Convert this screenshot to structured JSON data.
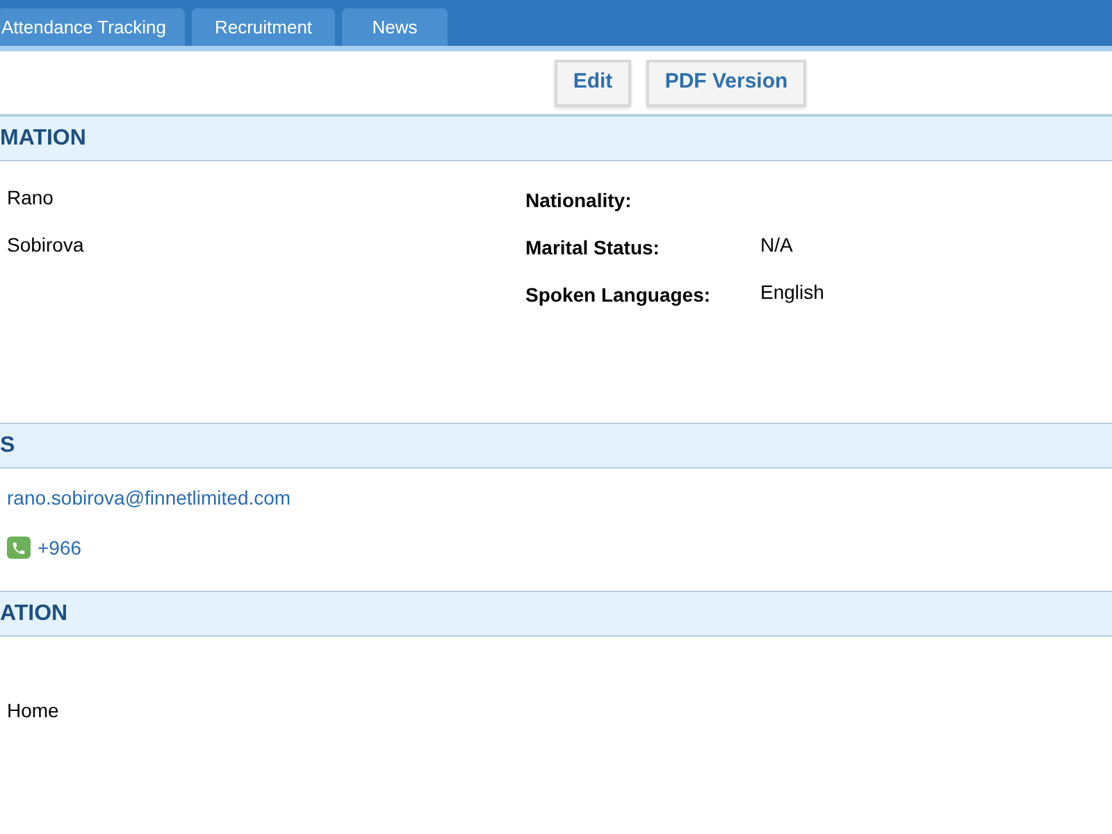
{
  "tabs": [
    {
      "label": "Attendance Tracking"
    },
    {
      "label": "Recruitment"
    },
    {
      "label": "News"
    }
  ],
  "buttons": [
    "Edit",
    "PDF Version"
  ],
  "sections": [
    {
      "title": "MATION",
      "kind": "details",
      "left": [
        "Rano",
        "Sobirova"
      ],
      "right": [
        {
          "label": "Nationality:"
        },
        {
          "label": "Marital Status:",
          "value": "N/A"
        },
        {
          "label": "Spoken Languages:",
          "value": "English"
        }
      ]
    },
    {
      "title": "S",
      "kind": "contacts",
      "email": "rano.sobirova@finnetlimited.com",
      "phone": "+966"
    },
    {
      "title": "ATION",
      "kind": "address",
      "lines": [
        "Home"
      ]
    }
  ]
}
